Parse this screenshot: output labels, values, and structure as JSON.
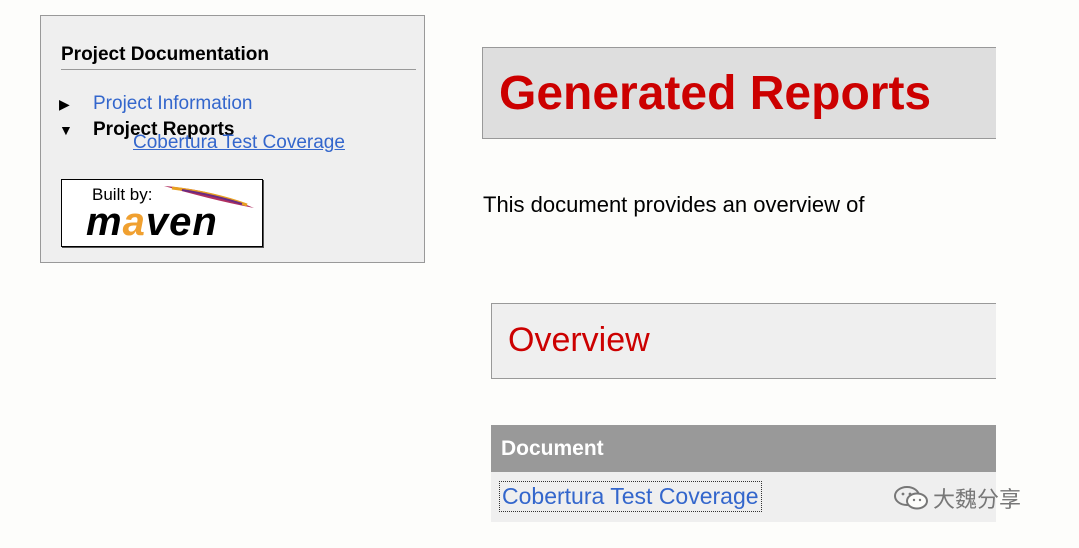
{
  "sidebar": {
    "heading": "Project Documentation",
    "items": [
      {
        "label": "Project Information",
        "arrow": "▶"
      },
      {
        "label": "Project Reports",
        "arrow": "▼"
      }
    ],
    "sub_items": [
      "Cobertura Test Coverage"
    ],
    "badge": {
      "built_by": "Built by:",
      "word": "maven"
    }
  },
  "main": {
    "title": "Generated Reports",
    "intro": "This document provides an overview of",
    "section_title": "Overview",
    "table": {
      "header": "Document",
      "rows": [
        "Cobertura Test Coverage"
      ]
    }
  },
  "watermark": "大魏分享",
  "colors": {
    "link": "#3366cc",
    "heading_red": "#cc0000"
  }
}
